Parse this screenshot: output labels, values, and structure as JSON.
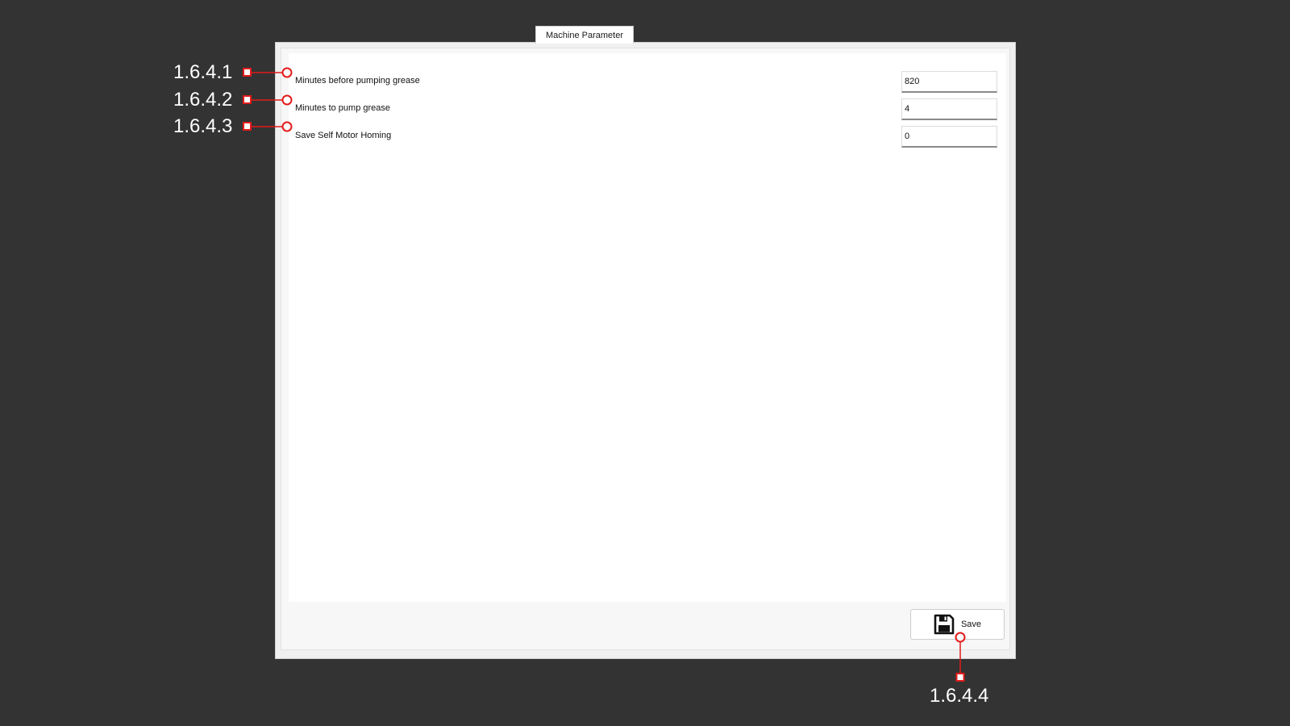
{
  "tab": {
    "title": "Machine Parameter"
  },
  "parameters": [
    {
      "label": "Minutes before pumping grease",
      "value": "820"
    },
    {
      "label": "Minutes to pump grease",
      "value": "4"
    },
    {
      "label": "Save Self Motor Homing",
      "value": "0"
    }
  ],
  "save_button": {
    "label": "Save",
    "icon": "floppy-disk-icon"
  },
  "annotations": {
    "a1": "1.6.4.1",
    "a2": "1.6.4.2",
    "a3": "1.6.4.3",
    "a4": "1.6.4.4",
    "color": "#e31b1b"
  }
}
